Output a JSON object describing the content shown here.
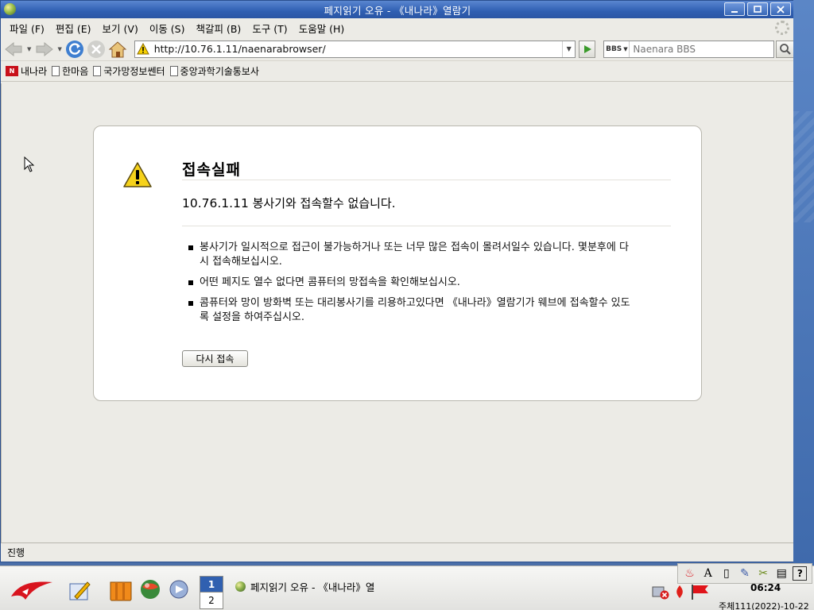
{
  "window": {
    "title": "페지읽기 오유 - 《내나라》열람기"
  },
  "menu": {
    "items": [
      "파일 (F)",
      "편집 (E)",
      "보기 (V)",
      "이동 (S)",
      "책갈피 (B)",
      "도구 (T)",
      "도움말 (H)"
    ]
  },
  "toolbar": {
    "url": "http://10.76.1.11/naenarabrowser/",
    "search_engine": "BBS",
    "search_placeholder": "Naenara BBS"
  },
  "bookmarks": [
    "내나라",
    "한마음",
    "국가망정보쎈터",
    "중앙과학기술통보사"
  ],
  "error": {
    "title": "접속실패",
    "host": "10.76.1.11",
    "message": "봉사기와 접속할수 없습니다.",
    "items": [
      "봉사기가 일시적으로 접근이 불가능하거나 또는 너무 많은 접속이 몰려서일수 있습니다. 몇분후에 다시 접속해보십시오.",
      "어떤 페지도 열수 없다면 콤퓨터의 망접속을 확인해보십시오.",
      "콤퓨터와 망이 방화벽 또는 대리봉사기를 리용하고있다면 《내나라》열람기가 웨브에 접속할수 있도록 설정을 하여주십시오."
    ],
    "retry_label": "다시 접속"
  },
  "status": {
    "text": "진행"
  },
  "taskbar": {
    "workspaces": [
      "1",
      "2"
    ],
    "task_title": "페지읽기 오유 - 《내나라》열",
    "clock_time": "06:24",
    "clock_date": "주체111(2022)-10-22"
  },
  "colors": {
    "titlebar": "#2f5fb2",
    "background": "#ecebe6",
    "desktop": "#4a6ea8"
  },
  "icons": [
    "back-icon",
    "forward-icon",
    "reload-icon",
    "stop-icon",
    "home-icon",
    "warning-icon",
    "go-icon",
    "search-icon"
  ]
}
